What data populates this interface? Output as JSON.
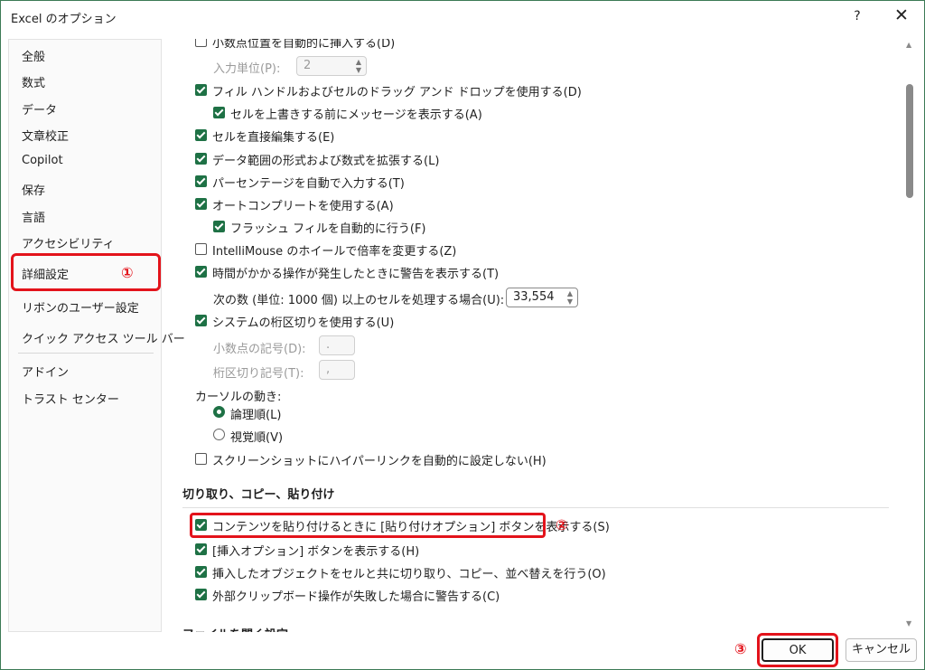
{
  "window": {
    "title": "Excel のオプション",
    "help_label": "?",
    "close_label": "✕"
  },
  "sidebar": {
    "items": [
      {
        "label": "全般"
      },
      {
        "label": "数式"
      },
      {
        "label": "データ"
      },
      {
        "label": "文章校正"
      },
      {
        "label": "Copilot"
      },
      {
        "label": "保存"
      },
      {
        "label": "言語"
      },
      {
        "label": "アクセシビリティ"
      },
      {
        "label": "詳細設定",
        "selected": true
      },
      {
        "label": "リボンのユーザー設定"
      },
      {
        "label": "クイック アクセス ツール バー"
      },
      {
        "label": "アドイン"
      },
      {
        "label": "トラスト センター"
      }
    ]
  },
  "markers": {
    "one": "①",
    "two": "②",
    "three": "③"
  },
  "options": {
    "decimal_insert": {
      "label": "小数点位置を自動的に挿入する(D)",
      "checked": false
    },
    "input_unit": {
      "label": "入力単位(P):",
      "value": "2"
    },
    "fill_handle": {
      "label": "フィル ハンドルおよびセルのドラッグ アンド ドロップを使用する(D)",
      "checked": true
    },
    "overwrite_alert": {
      "label": "セルを上書きする前にメッセージを表示する(A)",
      "checked": true
    },
    "edit_directly": {
      "label": "セルを直接編集する(E)",
      "checked": true
    },
    "extend_formats": {
      "label": "データ範囲の形式および数式を拡張する(L)",
      "checked": true
    },
    "auto_percent": {
      "label": "パーセンテージを自動で入力する(T)",
      "checked": true
    },
    "autocomplete": {
      "label": "オートコンプリートを使用する(A)",
      "checked": true
    },
    "flash_fill": {
      "label": "フラッシュ フィルを自動的に行う(F)",
      "checked": true
    },
    "intellimouse": {
      "label": "IntelliMouse のホイールで倍率を変更する(Z)",
      "checked": false
    },
    "slow_alert": {
      "label": "時間がかかる操作が発生したときに警告を表示する(T)",
      "checked": true
    },
    "cell_count": {
      "label": "次の数 (単位: 1000 個) 以上のセルを処理する場合(U):",
      "value": "33,554"
    },
    "system_separators": {
      "label": "システムの桁区切りを使用する(U)",
      "checked": true
    },
    "decimal_symbol": {
      "label": "小数点の記号(D):",
      "value": "."
    },
    "thousands_symbol": {
      "label": "桁区切り記号(T):",
      "value": ","
    },
    "cursor_movement": {
      "label": "カーソルの動き:"
    },
    "logical": {
      "label": "論理順(L)",
      "selected": true
    },
    "visual": {
      "label": "視覚順(V)",
      "selected": false
    },
    "no_hyperlink": {
      "label": "スクリーンショットにハイパーリンクを自動的に設定しない(H)",
      "checked": false
    }
  },
  "cut_copy_paste": {
    "title": "切り取り、コピー、貼り付け",
    "paste_options": {
      "label": "コンテンツを貼り付けるときに [貼り付けオプション] ボタンを表示する(S)",
      "checked": true
    },
    "insert_options": {
      "label": "[挿入オプション] ボタンを表示する(H)",
      "checked": true
    },
    "cut_objects": {
      "label": "挿入したオブジェクトをセルと共に切り取り、コピー、並べ替えを行う(O)",
      "checked": true
    },
    "clipboard_alert": {
      "label": "外部クリップボード操作が失敗した場合に警告する(C)",
      "checked": true
    }
  },
  "next_section": {
    "title": "ファイルを開く設定"
  },
  "buttons": {
    "ok": "OK",
    "cancel": "キャンセル"
  }
}
